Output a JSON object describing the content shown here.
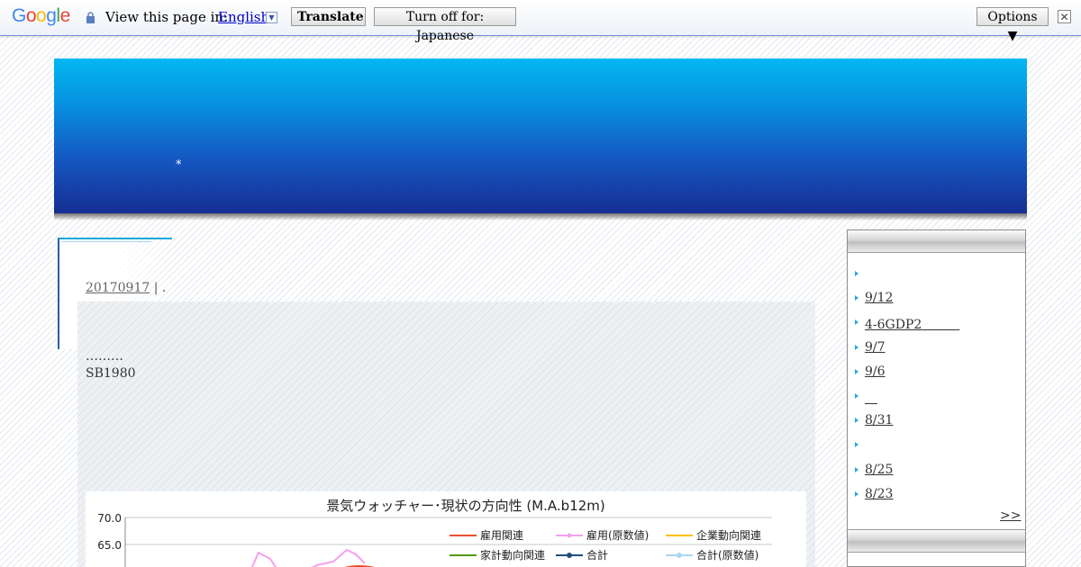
{
  "translate_bar": {
    "logo": "Google",
    "view_text": "View this page in:",
    "language": "English",
    "translate_button": "Translate",
    "turn_off_button": "Turn off for: Japanese",
    "options_button": "Options ▼",
    "close_symbol": "✕"
  },
  "header": {
    "star": "*",
    "colors": {
      "top": "#02b8f2",
      "bottom": "#162e93"
    }
  },
  "post": {
    "date": "20170917",
    "separator": "| .",
    "dots": "………",
    "line2": "SB1980"
  },
  "chart_image": {
    "title": "景気ウォッチャー･現状の方向性 (M.A.b12m)",
    "y_ticks": [
      "70.0",
      "65.0"
    ],
    "legend": [
      {
        "label": "雇用関連",
        "color": "#e8522b"
      },
      {
        "label": "雇用(原数値)",
        "color": "#f5a0f0"
      },
      {
        "label": "企業動向関連",
        "color": "#ffc000"
      },
      {
        "label": "家計動向関連",
        "color": "#4e9a06"
      },
      {
        "label": "合計",
        "color": "#1f4e79"
      },
      {
        "label": "合計(原数値)",
        "color": "#a8d8f0"
      }
    ]
  },
  "sidebar": {
    "items": [
      "",
      "9/12",
      "4-6GDP2　　　",
      "9/7",
      "9/6",
      "　",
      "8/31",
      "",
      "8/25",
      "8/23"
    ],
    "more": ">>",
    "bullet_color": "#2aa6e0"
  }
}
